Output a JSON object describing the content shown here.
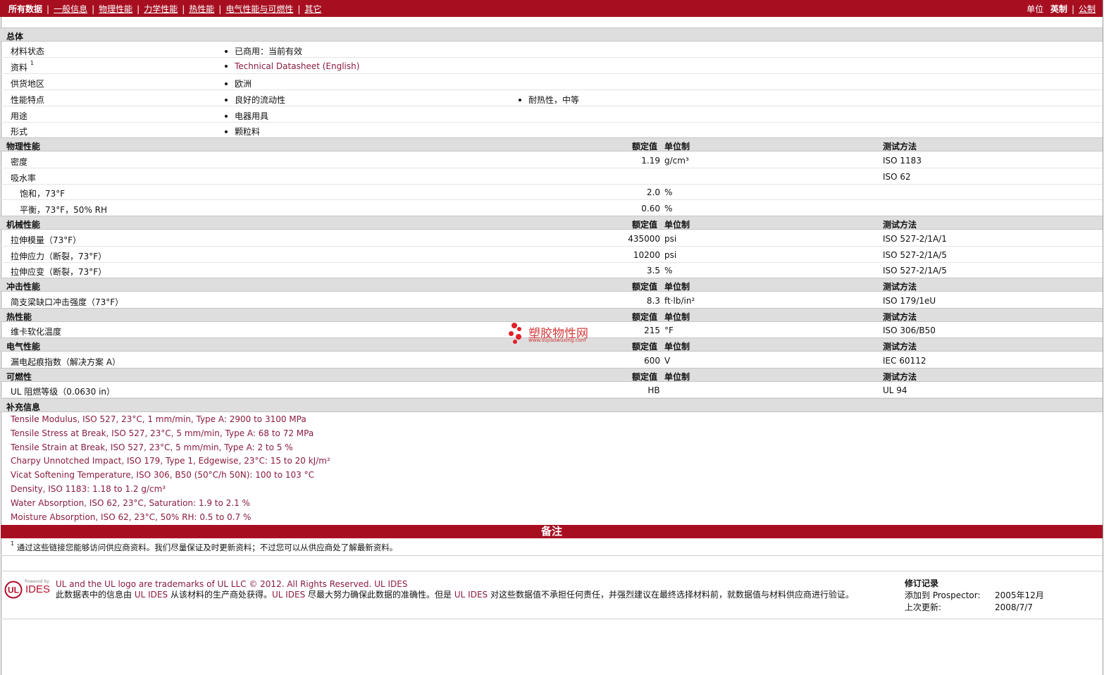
{
  "nav": {
    "tabs": [
      "所有数据",
      "一般信息",
      "物理性能",
      "力学性能",
      "热性能",
      "电气性能与可燃性",
      "其它"
    ],
    "unit_label": "单位",
    "unit_selected": "英制",
    "unit_other": "公制"
  },
  "general": {
    "title": "总体",
    "rows": [
      {
        "label": "材料状态",
        "values": [
          "已商用：当前有效"
        ]
      },
      {
        "label": "资料",
        "sup": "1",
        "values": [
          "Technical Datasheet (English)"
        ]
      },
      {
        "label": "供货地区",
        "values": [
          "欧洲"
        ]
      },
      {
        "label": "性能特点",
        "values": [
          "良好的流动性",
          "耐热性，中等"
        ]
      },
      {
        "label": "用途",
        "values": [
          "电器用具"
        ]
      },
      {
        "label": "形式",
        "values": [
          "颗粒料"
        ]
      }
    ]
  },
  "headers": {
    "nominal": "额定值",
    "unit": "单位制",
    "method": "测试方法"
  },
  "physical": {
    "title": "物理性能",
    "rows": [
      {
        "label": "密度",
        "value": "1.19",
        "unit": "g/cm³",
        "method": "ISO 1183"
      },
      {
        "label": "吸水率",
        "value": "",
        "unit": "",
        "method": "ISO 62"
      },
      {
        "label": "饱和，73°F",
        "value": "2.0",
        "unit": "%",
        "method": ""
      },
      {
        "label": "平衡，73°F，50% RH",
        "value": "0.60",
        "unit": "%",
        "method": ""
      }
    ]
  },
  "mechanical": {
    "title": "机械性能",
    "rows": [
      {
        "label": "拉伸模量（73°F）",
        "value": "435000",
        "unit": "psi",
        "method": "ISO 527-2/1A/1"
      },
      {
        "label": "拉伸应力（断裂，73°F）",
        "value": "10200",
        "unit": "psi",
        "method": "ISO 527-2/1A/5"
      },
      {
        "label": "拉伸应变（断裂，73°F）",
        "value": "3.5",
        "unit": "%",
        "method": "ISO 527-2/1A/5"
      }
    ]
  },
  "impact": {
    "title": "冲击性能",
    "rows": [
      {
        "label": "简支梁缺口冲击强度（73°F）",
        "value": "8.3",
        "unit": "ft·lb/in²",
        "method": "ISO 179/1eU"
      }
    ]
  },
  "thermal": {
    "title": "热性能",
    "rows": [
      {
        "label": "维卡软化温度",
        "value": "215",
        "unit": "°F",
        "method": "ISO 306/B50"
      }
    ]
  },
  "electrical": {
    "title": "电气性能",
    "rows": [
      {
        "label": "漏电起痕指数（解决方案 A）",
        "value": "600",
        "unit": "V",
        "method": "IEC 60112"
      }
    ]
  },
  "flammability": {
    "title": "可燃性",
    "rows": [
      {
        "label": "UL 阻燃等级（0.0630 in）",
        "value": "HB",
        "unit": "",
        "method": "UL 94"
      }
    ]
  },
  "supplemental": {
    "title": "补充信息",
    "lines": [
      "Tensile Modulus, ISO 527, 23°C, 1 mm/min, Type A: 2900 to 3100 MPa",
      "Tensile Stress at Break, ISO 527, 23°C, 5 mm/min, Type A: 68 to 72 MPa",
      "Tensile Strain at Break, ISO 527, 23°C, 5 mm/min, Type A: 2 to 5 %",
      "Charpy Unnotched Impact, ISO 179, Type 1, Edgewise, 23°C: 15 to 20 kJ/m²",
      "Vicat Softening Temperature, ISO 306, B50 (50°C/h 50N): 100 to 103 °C",
      "Density, ISO 1183: 1.18 to 1.2 g/cm³",
      "Water Absorption, ISO 62, 23°C, Saturation: 1.9 to 2.1 %",
      "Moisture Absorption, ISO 62, 23°C, 50% RH: 0.5 to 0.7 %"
    ]
  },
  "notes": {
    "title": "备注",
    "footnote_num": "1",
    "footnote": "通过这些链接您能够访问供应商资料。我们尽量保证及时更新资料；不过您可以从供应商处了解最新资料。"
  },
  "footer": {
    "logo_text": "IDES",
    "logo_small": "Powered by",
    "trademark": "UL and the UL logo are trademarks of UL LLC © 2012. All Rights Reserved.",
    "trademark_link": "UL IDES",
    "disclaimer_1": "此数据表中的信息由",
    "disclaimer_ul1": "UL IDES",
    "disclaimer_2": "从该材料的生产商处获得。",
    "disclaimer_ul2": "UL IDES",
    "disclaimer_3": "尽最大努力确保此数据的准确性。但是",
    "disclaimer_ul3": "UL IDES",
    "disclaimer_4": "对这些数据值不承担任何责任，并强烈建议在最终选择材料前，就数据值与材料供应商进行验证。",
    "revision_title": "修订记录",
    "added_label": "添加到 Prospector:",
    "added_value": "2005年12月",
    "updated_label": "上次更新:",
    "updated_value": "2008/7/7"
  },
  "watermark": {
    "text": "塑胶物性网",
    "url": "www.sujiaowuxing.com"
  },
  "colors": {
    "brand": "#a70f21",
    "link": "#8a1c3c",
    "section_bg": "#dedede"
  }
}
